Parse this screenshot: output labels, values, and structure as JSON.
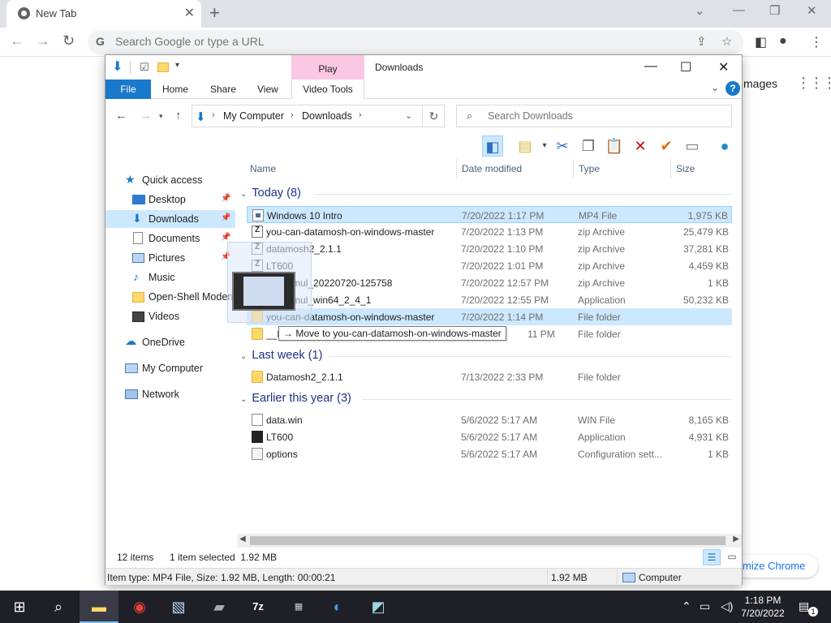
{
  "chrome": {
    "tab_title": "New Tab",
    "omnibox_placeholder": "Search Google or type a URL",
    "bg_images_link": "mages",
    "bg_customize": "mize Chrome"
  },
  "explorer": {
    "title": "Downloads",
    "play_tab": "Play",
    "ribbon_tabs": {
      "file": "File",
      "home": "Home",
      "share": "Share",
      "view": "View",
      "video_tools": "Video Tools"
    },
    "help": "?",
    "address": {
      "crumbs": [
        "My Computer",
        "Downloads"
      ]
    },
    "search_placeholder": "Search Downloads",
    "navpane": {
      "quick_access": "Quick access",
      "items": [
        "Desktop",
        "Downloads",
        "Documents",
        "Pictures",
        "Music",
        "Open-Shell Modern",
        "Videos"
      ],
      "onedrive": "OneDrive",
      "my_computer": "My Computer",
      "network": "Network"
    },
    "columns": {
      "name": "Name",
      "date": "Date modified",
      "type": "Type",
      "size": "Size"
    },
    "groups": {
      "today": "Today (8)",
      "last_week": "Last week (1)",
      "earlier": "Earlier this year (3)"
    },
    "today_files": [
      {
        "name": "Windows 10 Intro",
        "date": "7/20/2022 1:17 PM",
        "type": "MP4 File",
        "size": "1,975 KB"
      },
      {
        "name": "you-can-datamosh-on-windows-master",
        "date": "7/20/2022 1:13 PM",
        "type": "zip Archive",
        "size": "25,479 KB"
      },
      {
        "name": "datamosh2_2.1.1",
        "date": "7/20/2022 1:10 PM",
        "type": "zip Archive",
        "size": "37,281 KB"
      },
      {
        "name": "LT600",
        "date": "7/20/2022 1:01 PM",
        "type": "zip Archive",
        "size": "4,459 KB"
      },
      {
        "name": "pockemul_20220720-125758",
        "date": "7/20/2022 12:57 PM",
        "type": "zip Archive",
        "size": "1 KB"
      },
      {
        "name": "pockemul_win64_2_4_1",
        "date": "7/20/2022 12:55 PM",
        "type": "Application",
        "size": "50,232 KB"
      },
      {
        "name": "you-can-datamosh-on-windows-master",
        "date": "7/20/2022 1:14 PM",
        "type": "File folder",
        "size": ""
      },
      {
        "name": "__M",
        "date": "11 PM",
        "type": "File folder",
        "size": ""
      }
    ],
    "last_week_files": [
      {
        "name": "Datamosh2_2.1.1",
        "date": "7/13/2022 2:33 PM",
        "type": "File folder",
        "size": ""
      }
    ],
    "earlier_files": [
      {
        "name": "data.win",
        "date": "5/6/2022 5:17 AM",
        "type": "WIN File",
        "size": "8,165 KB"
      },
      {
        "name": "LT600",
        "date": "5/6/2022 5:17 AM",
        "type": "Application",
        "size": "4,931 KB"
      },
      {
        "name": "options",
        "date": "5/6/2022 5:17 AM",
        "type": "Configuration sett...",
        "size": "1 KB"
      }
    ],
    "drop_tip": "→ Move to you-can-datamosh-on-windows-master",
    "status": {
      "items": "12 items",
      "selected": "1 item selected  1.92 MB"
    },
    "status2": {
      "info": "Item type: MP4 File, Size: 1.92 MB, Length: 00:00:21",
      "size": "1.92 MB",
      "location": "Computer"
    }
  },
  "taskbar": {
    "time": "1:18 PM",
    "date": "7/20/2022",
    "notifications": "1"
  }
}
